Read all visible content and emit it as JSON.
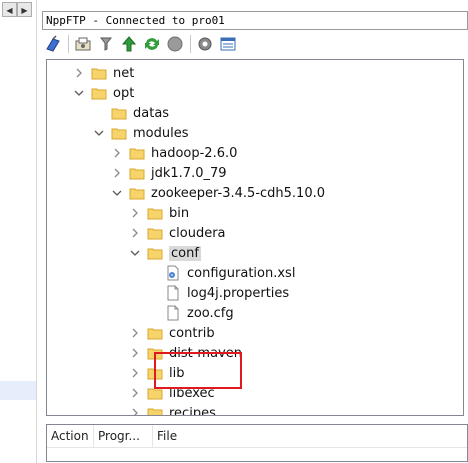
{
  "window": {
    "title": "NppFTP - Connected to pro01"
  },
  "toolbar": {
    "buttons": [
      {
        "icon": "connect-icon"
      },
      {
        "icon": "download-icon"
      },
      {
        "icon": "upload-filter-icon"
      },
      {
        "icon": "upload-icon"
      },
      {
        "icon": "refresh-icon"
      },
      {
        "icon": "abort-icon"
      },
      {
        "icon": "settings-icon"
      },
      {
        "icon": "message-window-icon"
      }
    ]
  },
  "tree": {
    "items": [
      {
        "label": "net",
        "type": "folder",
        "state": "collapsed"
      },
      {
        "label": "opt",
        "type": "folder",
        "state": "expanded"
      },
      {
        "label": "datas",
        "type": "folder",
        "state": "leaf"
      },
      {
        "label": "modules",
        "type": "folder",
        "state": "expanded"
      },
      {
        "label": "hadoop-2.6.0",
        "type": "folder",
        "state": "collapsed"
      },
      {
        "label": "jdk1.7.0_79",
        "type": "folder",
        "state": "collapsed"
      },
      {
        "label": "zookeeper-3.4.5-cdh5.10.0",
        "type": "folder",
        "state": "expanded"
      },
      {
        "label": "bin",
        "type": "folder",
        "state": "collapsed"
      },
      {
        "label": "cloudera",
        "type": "folder",
        "state": "collapsed"
      },
      {
        "label": "conf",
        "type": "folder",
        "state": "expanded"
      },
      {
        "label": "configuration.xsl",
        "type": "xsl-file",
        "state": "file"
      },
      {
        "label": "log4j.properties",
        "type": "file",
        "state": "file"
      },
      {
        "label": "zoo.cfg",
        "type": "file",
        "state": "file"
      },
      {
        "label": "contrib",
        "type": "folder",
        "state": "collapsed"
      },
      {
        "label": "dist-maven",
        "type": "folder",
        "state": "collapsed"
      },
      {
        "label": "lib",
        "type": "folder",
        "state": "collapsed"
      },
      {
        "label": "libexec",
        "type": "folder",
        "state": "collapsed"
      },
      {
        "label": "recipes",
        "type": "folder",
        "state": "collapsed"
      }
    ],
    "selected": "conf"
  },
  "queue": {
    "columns": [
      {
        "label": "Action"
      },
      {
        "label": "Progr..."
      },
      {
        "label": "File"
      }
    ]
  },
  "colors": {
    "highlight": "#e0191f",
    "folder": "#f6d36b"
  }
}
